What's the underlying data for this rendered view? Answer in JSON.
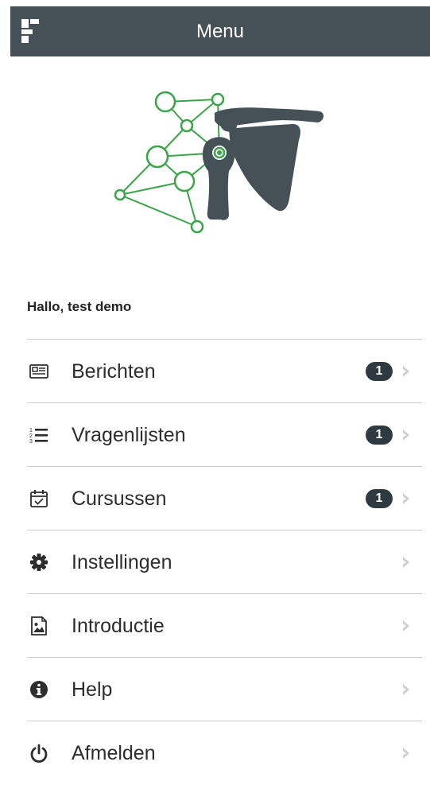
{
  "header": {
    "title": "Menu",
    "logo_icon": "app-logo-icon",
    "background": "#455057"
  },
  "illustration": {
    "icon": "shoulder-network-illustration",
    "accent": "#3aa548",
    "body_color": "#455057"
  },
  "greeting": "Hallo, test demo",
  "menu": {
    "items": [
      {
        "label": "Berichten",
        "icon": "newspaper-icon",
        "badge": "1"
      },
      {
        "label": "Vragenlijsten",
        "icon": "numbered-list-icon",
        "badge": "1"
      },
      {
        "label": "Cursussen",
        "icon": "calendar-check-icon",
        "badge": "1"
      },
      {
        "label": "Instellingen",
        "icon": "gear-icon",
        "badge": null
      },
      {
        "label": "Introductie",
        "icon": "image-file-icon",
        "badge": null
      },
      {
        "label": "Help",
        "icon": "info-icon",
        "badge": null
      },
      {
        "label": "Afmelden",
        "icon": "power-icon",
        "badge": null
      }
    ]
  }
}
